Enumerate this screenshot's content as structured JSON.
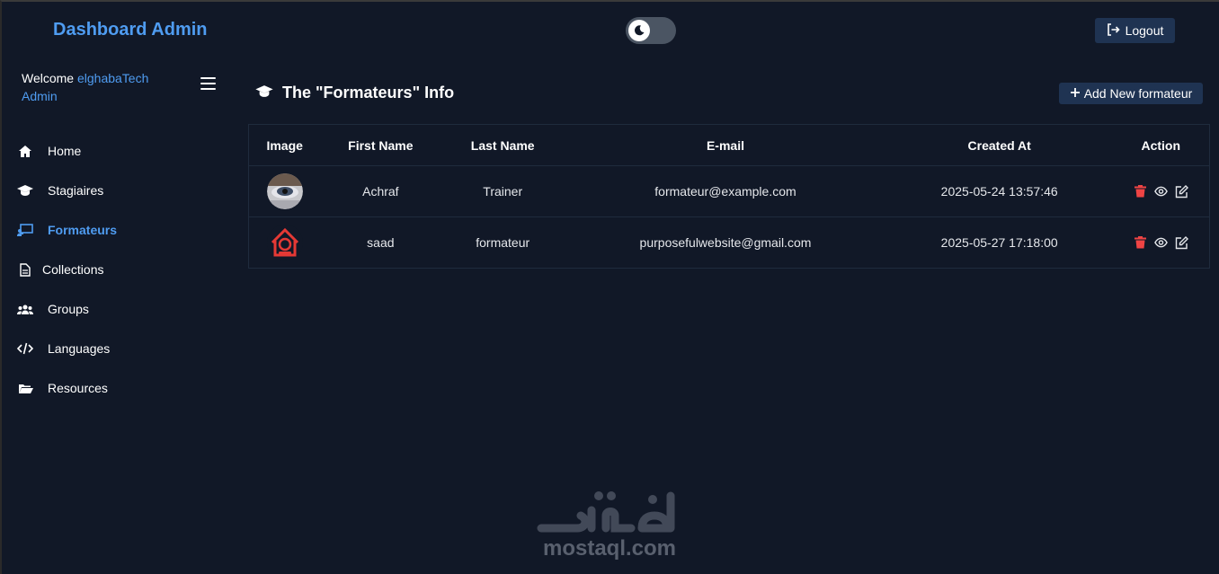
{
  "header": {
    "brand": "Dashboard Admin",
    "logout_label": "Logout"
  },
  "sidebar": {
    "welcome_prefix": "Welcome",
    "user_name": "elghabaTech",
    "user_role": "Admin",
    "items": [
      {
        "label": "Home",
        "icon": "home-icon"
      },
      {
        "label": "Stagiaires",
        "icon": "graduation-cap-icon"
      },
      {
        "label": "Formateurs",
        "icon": "chalkboard-teacher-icon",
        "active": true
      },
      {
        "label": "Collections",
        "icon": "file-icon"
      },
      {
        "label": "Groups",
        "icon": "users-icon"
      },
      {
        "label": "Languages",
        "icon": "code-icon"
      },
      {
        "label": "Resources",
        "icon": "folder-open-icon"
      }
    ]
  },
  "main": {
    "title": "The \"Formateurs\" Info",
    "add_button_label": "Add New formateur",
    "table": {
      "columns": [
        "Image",
        "First Name",
        "Last Name",
        "E-mail",
        "Created At",
        "Action"
      ],
      "rows": [
        {
          "first_name": "Achraf",
          "last_name": "Trainer",
          "email": "formateur@example.com",
          "created_at": "2025-05-24 13:57:46"
        },
        {
          "first_name": "saad",
          "last_name": "formateur",
          "email": "purposefulwebsite@gmail.com",
          "created_at": "2025-05-27 17:18:00"
        }
      ]
    }
  },
  "watermark": {
    "text": "mostaql.com"
  },
  "colors": {
    "background": "#111827",
    "accent": "#4f9cf1",
    "button_bg": "#1f3352",
    "delete": "#ef4444"
  }
}
